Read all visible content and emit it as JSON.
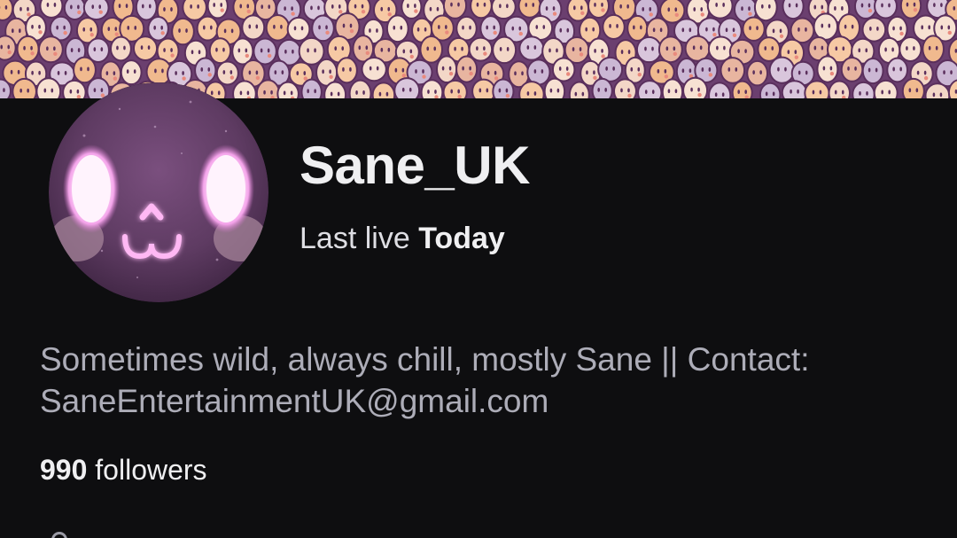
{
  "banner": {
    "icon": "emoji-pattern-banner"
  },
  "channel": {
    "avatar_icon": "glowing-face-avatar",
    "display_name": "Sane_UK",
    "last_live_prefix": "Last live",
    "last_live_value": "Today"
  },
  "about": {
    "bio_line1": "Sometimes wild, always chill, mostly Sane || Contact:",
    "bio_line2": "SaneEntertainmentUK@gmail.com",
    "followers_count": "990",
    "followers_label": "followers"
  },
  "colors": {
    "background": "#0e0e10",
    "banner_purple": "#6b3f6f",
    "text_primary": "#efeff1",
    "text_secondary": "#adadb8",
    "avatar_glow": "#ff9cf2"
  }
}
